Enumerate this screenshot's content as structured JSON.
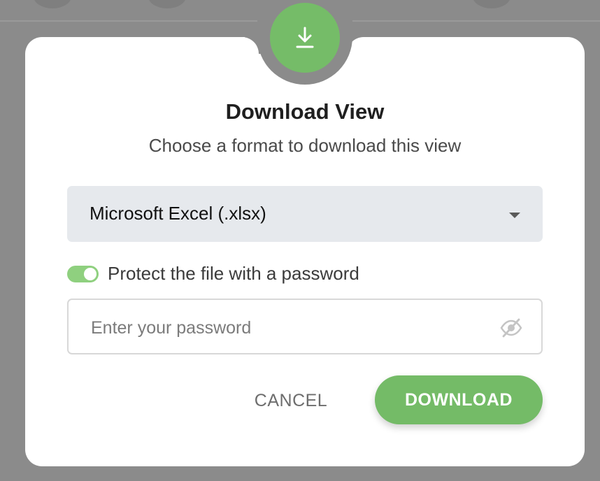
{
  "dialog": {
    "title": "Download View",
    "subtitle": "Choose a format to download this view",
    "icon": "download-icon",
    "accent_color": "#75bc68"
  },
  "format_select": {
    "selected": "Microsoft Excel (.xlsx)",
    "icon": "chevron-down-icon"
  },
  "password_toggle": {
    "label": "Protect the file with a password",
    "enabled": true
  },
  "password_field": {
    "value": "",
    "placeholder": "Enter your password",
    "icon": "eye-off-icon"
  },
  "buttons": {
    "cancel_label": "CANCEL",
    "download_label": "DOWNLOAD"
  }
}
